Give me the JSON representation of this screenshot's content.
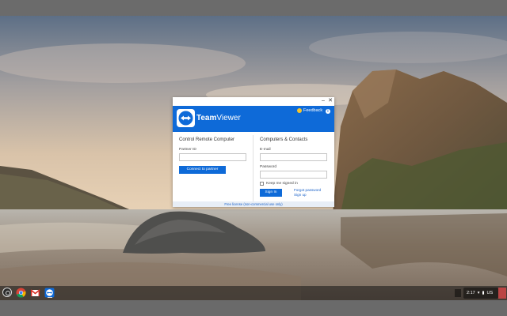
{
  "teamviewer": {
    "window_controls": {
      "minimize": "–",
      "close": "✕"
    },
    "brand_bold": "Team",
    "brand_light": "Viewer",
    "feedback_label": "Feedback",
    "info_glyph": "i",
    "left": {
      "title": "Control Remote Computer",
      "partner_label": "Partner ID",
      "partner_value": "",
      "connect_button": "Connect to partner"
    },
    "right": {
      "title": "Computers & Contacts",
      "email_label": "E-mail",
      "email_value": "",
      "password_label": "Password",
      "password_value": "",
      "keep_signed_in": "Keep me signed in",
      "sign_in_button": "Sign In",
      "forgot_password": "Forgot password",
      "sign_up": "Sign up"
    },
    "footer": "Free license (non-commercial use only)",
    "colors": {
      "brand_blue": "#0e6ad8",
      "link_blue": "#1b62c9"
    }
  },
  "shelf": {
    "apps": [
      {
        "name": "Chrome",
        "icon": "chrome-icon"
      },
      {
        "name": "Gmail",
        "icon": "gmail-icon"
      },
      {
        "name": "TeamViewer",
        "icon": "teamviewer-icon"
      }
    ],
    "tray": {
      "time": "2:17",
      "locale": "US"
    }
  }
}
